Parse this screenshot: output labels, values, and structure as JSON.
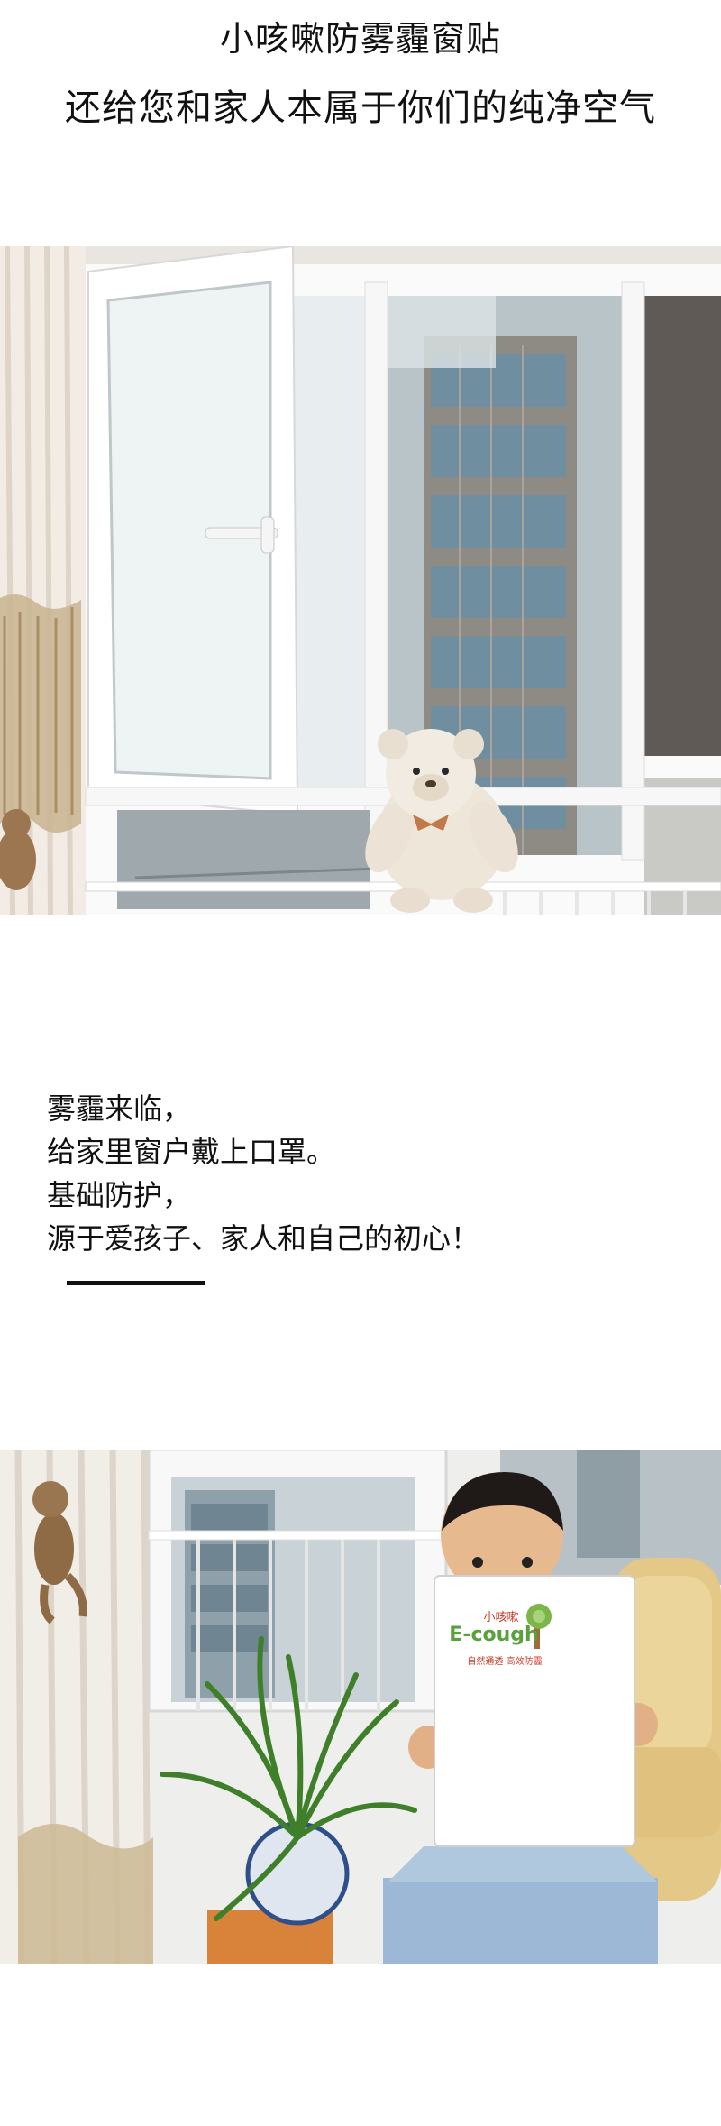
{
  "heading": {
    "line1": "小咳嗽防雾霾窗贴",
    "line2": "还给您和家人本属于你们的纯净空气"
  },
  "copy": {
    "lines": [
      "雾霾来临，",
      "给家里窗户戴上口罩。",
      "基础防护，",
      "源于爱孩子、家人和自己的初心！"
    ]
  },
  "product_card": {
    "brand_cn": "小咳嗽",
    "brand_en": "E-cough",
    "tagline": "自然通透 高效防霾"
  },
  "colors": {
    "text": "#111111",
    "brand_green": "#5aa03c",
    "brand_red": "#d23c2a",
    "divider": "#111111"
  }
}
